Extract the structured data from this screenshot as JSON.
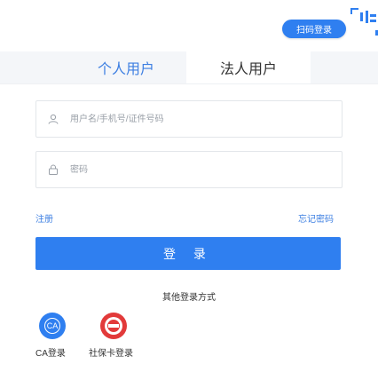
{
  "header": {
    "scan_login_label": "扫码登录"
  },
  "tabs": [
    {
      "label": "个人用户",
      "active": true
    },
    {
      "label": "法人用户",
      "active": false
    }
  ],
  "form": {
    "username_placeholder": "用户名/手机号/证件号码",
    "password_placeholder": "密码",
    "register_label": "注册",
    "forgot_label": "忘记密码",
    "login_label": "登 录"
  },
  "other_login": {
    "title": "其他登录方式",
    "methods": [
      {
        "label": "CA登录",
        "icon_text": "CA",
        "icon": "ca-icon"
      },
      {
        "label": "社保卡登录",
        "icon": "social-security-card-icon"
      }
    ]
  },
  "colors": {
    "primary": "#2f7ff0",
    "tab_active_text": "#3d7fe2",
    "tab_bg": "#f4f6f9"
  }
}
